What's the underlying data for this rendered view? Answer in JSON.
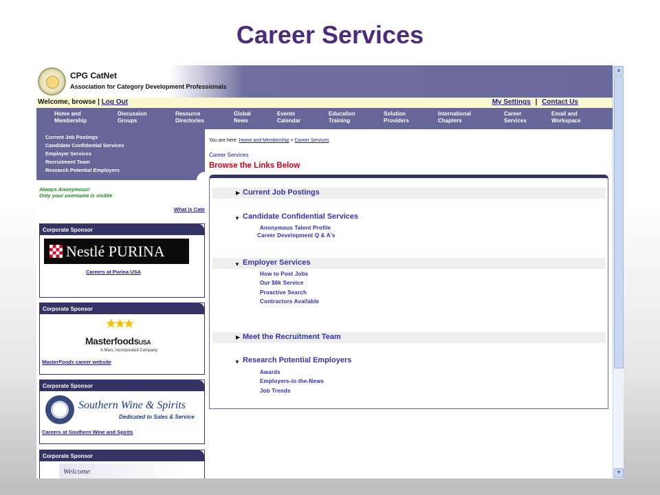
{
  "slide_title": "Career Services",
  "site": {
    "name": "CPG CatNet",
    "tagline": "Association for Category Development Professionals"
  },
  "welcome_bar": {
    "welcome": "Welcome, browse",
    "separator": "|",
    "logout": "Log Out",
    "my_settings": "My Settings",
    "contact_us": "Contact Us"
  },
  "nav": [
    {
      "line1": "Home and",
      "line2": "Membership"
    },
    {
      "line1": "Discussion",
      "line2": "Groups"
    },
    {
      "line1": "Resource",
      "line2": "Directories"
    },
    {
      "line1": "Global",
      "line2": "News"
    },
    {
      "line1": "Events",
      "line2": "Calendar"
    },
    {
      "line1": "Education",
      "line2": "Training"
    },
    {
      "line1": "Solution",
      "line2": "Providers"
    },
    {
      "line1": "International",
      "line2": "Chapters"
    },
    {
      "line1": "Career",
      "line2": "Services"
    },
    {
      "line1": "Email and",
      "line2": "Workspace"
    }
  ],
  "side_menu": [
    "Current Job Postings",
    "Candidate Confidential Services",
    "Employer Services",
    "Recruitment Team",
    "Research Potential Employers"
  ],
  "anonymous": {
    "line1": "Always Anonymous!",
    "line2": "Only your username is visible"
  },
  "what_is": "What is Cate",
  "sponsors": [
    {
      "header": "Corporate Sponsor",
      "logo_text": "Nestlé PURINA",
      "link": "Careers at Purina USA"
    },
    {
      "header": "Corporate Sponsor",
      "logo_brand": "Masterfoods",
      "logo_suffix": "USA",
      "logo_sub": "A Mars, Incorporated Company",
      "link_pre": "Master",
      "link_italic": "Foods",
      "link_post": " career website"
    },
    {
      "header": "Corporate Sponsor",
      "logo_name": "Southern Wine & Spirits",
      "logo_sub": "Dedicated to Sales & Service",
      "link": "Careers at Southern Wine and Spirits"
    },
    {
      "header": "Corporate Sponsor",
      "banner": "Welcome"
    }
  ],
  "breadcrumb": {
    "prefix": "You are here:",
    "home": "Home and Membership",
    "sep": ">",
    "current": "Career Services"
  },
  "section_label": "Career Services",
  "browse_heading": "Browse the Links Below",
  "categories": [
    {
      "label": "Current Job Postings",
      "expanded": false,
      "links": []
    },
    {
      "label": "Candidate Confidential Services",
      "expanded": true,
      "links": [
        "Anonymous Talent Profile",
        "Career Development Q & A's"
      ]
    },
    {
      "label": "Employer Services",
      "expanded": true,
      "links": [
        "How to Post Jobs",
        "Our $6k Service",
        "Proactive Search",
        "Contractors Available"
      ]
    },
    {
      "label": "Meet the Recruitment Team",
      "expanded": false,
      "links": []
    },
    {
      "label": "Research Potential Employers",
      "expanded": true,
      "links": [
        "Awards",
        "Employers-in-the-News",
        "Job Trends"
      ]
    }
  ],
  "colors": {
    "title": "#4b2c7b",
    "nav_bg": "#666699",
    "header_dark": "#333366",
    "link": "#3333aa",
    "heading_red": "#d0021b",
    "anon_green": "#1a8a1a"
  }
}
